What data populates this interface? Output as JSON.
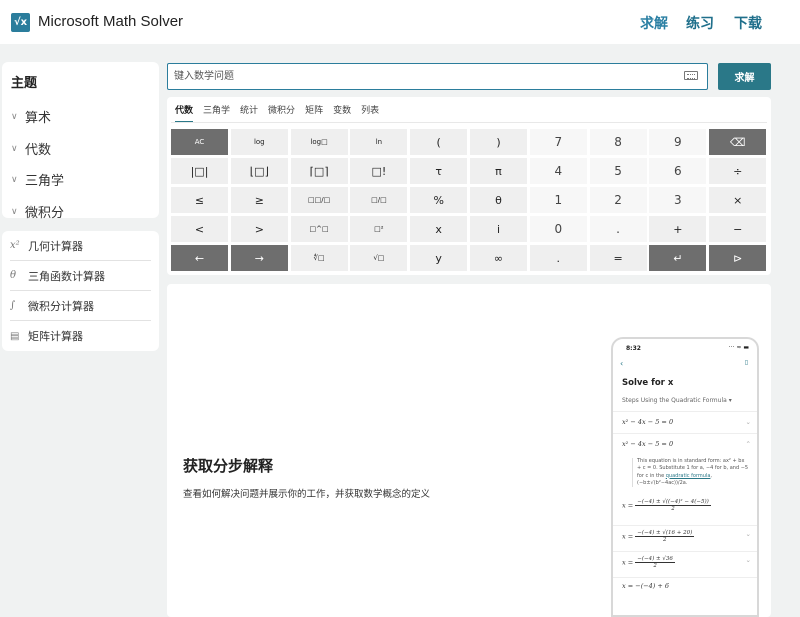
{
  "app": {
    "title": "Microsoft Math Solver",
    "logo_glyph": "√x"
  },
  "nav": [
    {
      "label": "求解",
      "color": "#2a7fa3"
    },
    {
      "label": "练习",
      "color": "#1f6f8b"
    },
    {
      "label": "下载",
      "color": "#1f6f8b"
    }
  ],
  "sidebar": {
    "heading": "主题",
    "topics": [
      "算术",
      "代数",
      "三角学",
      "微积分"
    ],
    "calculators": [
      {
        "label": "几何计算器",
        "icon": "x-squared-icon"
      },
      {
        "label": "三角函数计算器",
        "icon": "theta-icon"
      },
      {
        "label": "微积分计算器",
        "icon": "integral-icon"
      },
      {
        "label": "矩阵计算器",
        "icon": "matrix-icon"
      }
    ]
  },
  "search": {
    "placeholder": "键入数学问题",
    "value": "",
    "button": "求解"
  },
  "keypad": {
    "tabs": [
      "代数",
      "三角学",
      "统计",
      "微积分",
      "矩阵",
      "变数",
      "列表"
    ],
    "active_tab": "代数",
    "keys": [
      "AC",
      "log",
      "log□",
      "ln",
      "(",
      ")",
      "7",
      "8",
      "9",
      "⌫",
      "|□|",
      "⌊□⌋",
      "⌈□⌉",
      "□!",
      "τ",
      "π",
      "4",
      "5",
      "6",
      "÷",
      "≤",
      "≥",
      "□□/□",
      "□/□",
      "%",
      "θ",
      "1",
      "2",
      "3",
      "×",
      "<",
      ">",
      "□^□",
      "□²",
      "x",
      "i",
      "0",
      ".",
      "+",
      "−",
      "←",
      "→",
      "∜□",
      "√□",
      "y",
      "∞",
      ".",
      "=",
      "↵",
      "⊳"
    ]
  },
  "promo": {
    "title": "获取分步解释",
    "description": "查看如何解决问题并展示你的工作，并获取数学概念的定义"
  },
  "phone": {
    "time": "8:32",
    "heading": "Solve for x",
    "subheading": "Steps Using the Quadratic Formula",
    "eq1": "x² − 4x − 5 = 0",
    "eq2": "x² − 4x − 5 = 0",
    "note_pre": "This equation is in standard form: ax² + bx + c = 0. Substitute 1 for a, −4 for b, and −5 for c in the",
    "note_link": "quadratic formula",
    "note_post": ", (−b±√(b²−4ac))/2a.",
    "step1_num": "−(−4) ± √((−4)² − 4(−5))",
    "step1_den": "2",
    "step2_num": "−(−4) ± √(16 + 20)",
    "step2_den": "2",
    "step3_num": "−(−4) ± √36",
    "step3_den": "2",
    "step4": "x = −(−4) + 6"
  }
}
